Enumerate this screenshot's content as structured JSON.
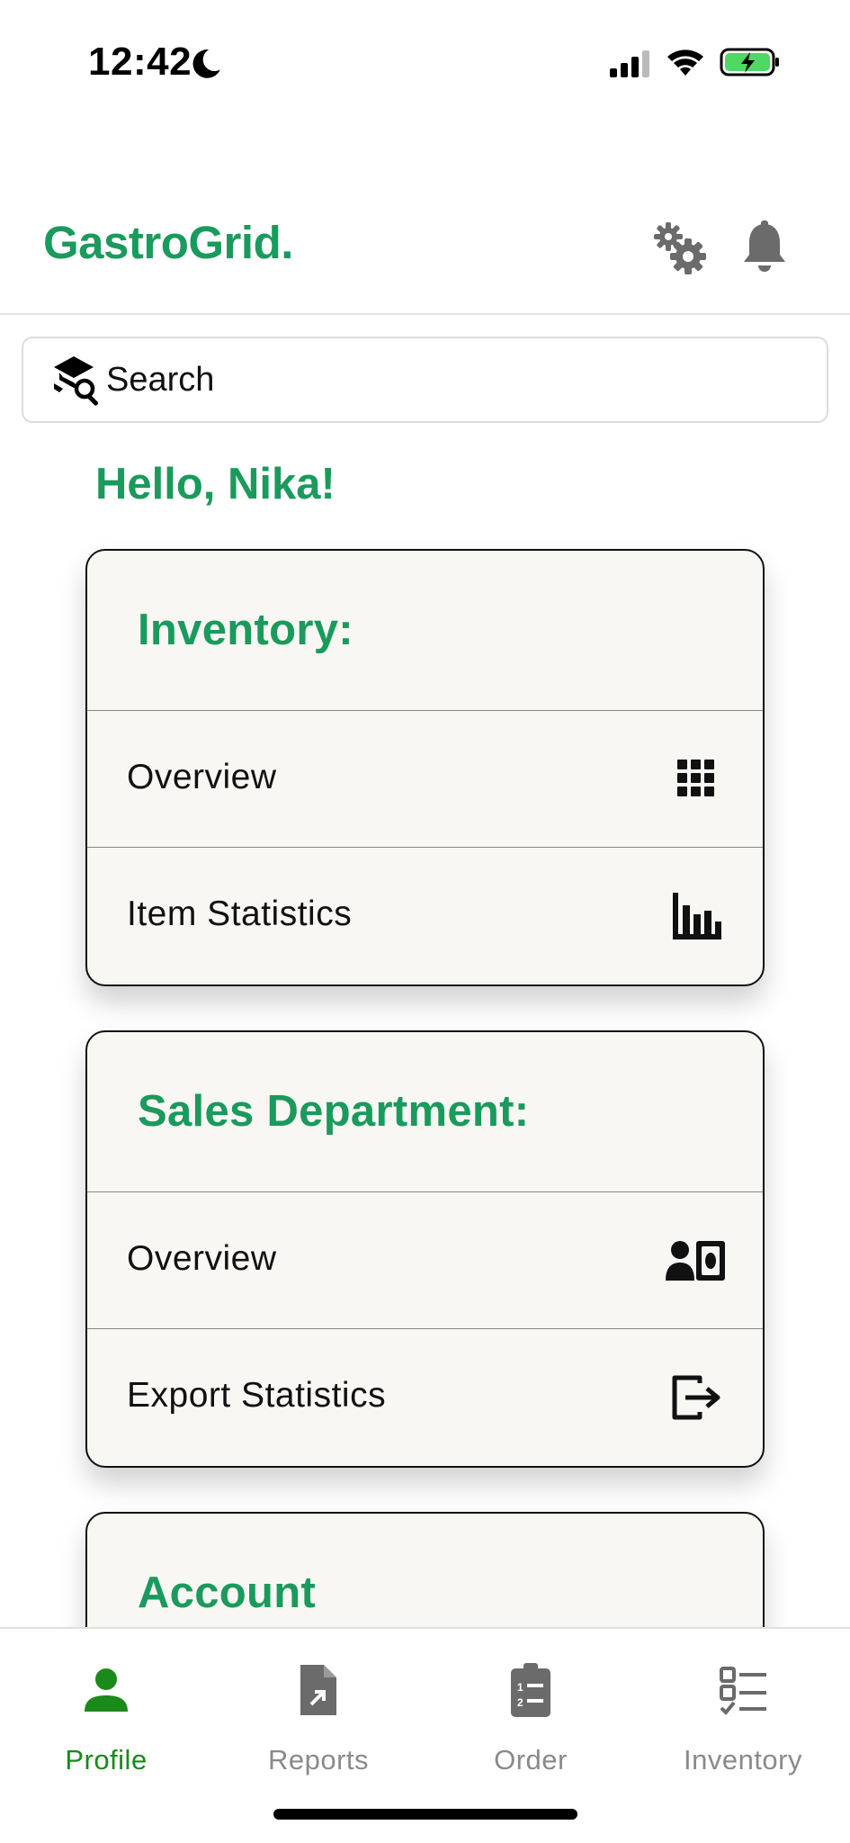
{
  "status_bar": {
    "time": "12:42"
  },
  "header": {
    "brand": "GastroGrid.",
    "settings_icon": "gears-icon",
    "notification_icon": "bell-icon"
  },
  "search": {
    "placeholder": "Search",
    "icon": "search-icon"
  },
  "greeting": "Hello, Nika!",
  "cards": {
    "inventory": {
      "title": "Inventory:",
      "rows": [
        {
          "label": "Overview",
          "icon": "grid-icon"
        },
        {
          "label": "Item Statistics",
          "icon": "bar-chart-icon"
        }
      ]
    },
    "sales": {
      "title": "Sales Department:",
      "rows": [
        {
          "label": "Overview",
          "icon": "person-money-icon"
        },
        {
          "label": "Export Statistics",
          "icon": "export-icon"
        }
      ]
    },
    "account": {
      "title": "Account"
    }
  },
  "bottom_nav": {
    "items": [
      {
        "label": "Profile",
        "icon": "person-icon",
        "active": true
      },
      {
        "label": "Reports",
        "icon": "file-icon",
        "active": false
      },
      {
        "label": "Order",
        "icon": "clipboard-list-icon",
        "active": false
      },
      {
        "label": "Inventory",
        "icon": "checklist-icon",
        "active": false
      }
    ]
  },
  "colors": {
    "brand_green": "#1a9a5c",
    "active_nav": "#1a8a1a",
    "inactive_nav": "#8a8a8a",
    "card_bg": "#f8f7f4"
  }
}
